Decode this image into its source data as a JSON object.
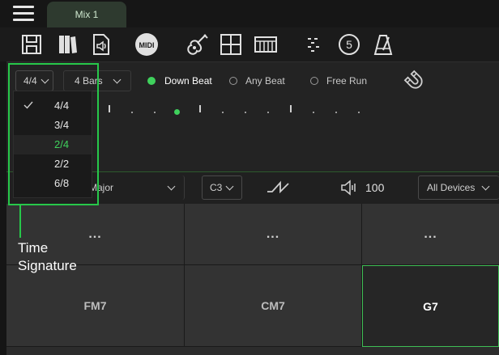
{
  "app": {
    "tab_label": "Mix 1"
  },
  "toolbar": {
    "icons": [
      "save-icon",
      "library-icon",
      "audio-file-icon",
      "midi-icon",
      "guitar-icon",
      "grid-icon",
      "piano-icon",
      "rhythm-icon",
      "count-in-icon",
      "metronome-icon"
    ],
    "midi_label": "MIDI",
    "count_label": "5"
  },
  "controls": {
    "time_signature": "4/4",
    "bars": "4 Bars",
    "radio": [
      {
        "label": "Down Beat",
        "selected": true
      },
      {
        "label": "Any Beat",
        "selected": false
      },
      {
        "label": "Free Run",
        "selected": false
      }
    ]
  },
  "dropdown": {
    "options": [
      "4/4",
      "3/4",
      "2/4",
      "2/2",
      "6/8"
    ],
    "checked": "4/4",
    "highlighted": "2/4"
  },
  "bar2": {
    "scale": "Major",
    "octave": "C3",
    "volume": "100",
    "devices": "All Devices"
  },
  "grid": {
    "dots": "...",
    "chords": [
      "FM7",
      "CM7",
      "G7"
    ],
    "selected": "G7"
  },
  "callout": {
    "line1": "Time",
    "line2": "Signature"
  },
  "colors": {
    "accent": "#3fd15c",
    "callout": "#27c84a"
  }
}
